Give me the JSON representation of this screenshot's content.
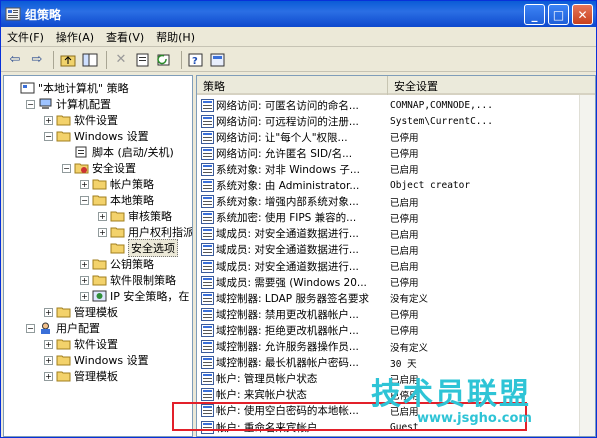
{
  "window": {
    "title": "组策略",
    "minimize": "_",
    "maximize": "□",
    "close": "✕"
  },
  "menu": [
    "文件(F)",
    "操作(A)",
    "查看(V)",
    "帮助(H)"
  ],
  "toolbar_icons": [
    "back-icon",
    "forward-icon",
    "up-folder-icon",
    "show-hide-tree-icon",
    "delete-icon",
    "properties-icon",
    "refresh-icon",
    "help-icon",
    "export-icon"
  ],
  "tree": [
    {
      "label": "\"本地计算机\" 策略",
      "indent": 0,
      "expander": "",
      "icon": "policy"
    },
    {
      "label": "计算机配置",
      "indent": 1,
      "expander": "−",
      "icon": "computer"
    },
    {
      "label": "软件设置",
      "indent": 2,
      "expander": "+",
      "icon": "folder"
    },
    {
      "label": "Windows 设置",
      "indent": 2,
      "expander": "−",
      "icon": "folder"
    },
    {
      "label": "脚本 (启动/关机)",
      "indent": 3,
      "expander": "",
      "icon": "script"
    },
    {
      "label": "安全设置",
      "indent": 3,
      "expander": "−",
      "icon": "security"
    },
    {
      "label": "帐户策略",
      "indent": 4,
      "expander": "+",
      "icon": "folder"
    },
    {
      "label": "本地策略",
      "indent": 4,
      "expander": "−",
      "icon": "folder"
    },
    {
      "label": "审核策略",
      "indent": 5,
      "expander": "+",
      "icon": "folder"
    },
    {
      "label": "用户权利指派",
      "indent": 5,
      "expander": "+",
      "icon": "folder"
    },
    {
      "label": "安全选项",
      "indent": 5,
      "expander": "",
      "icon": "folder",
      "selected": true
    },
    {
      "label": "公钥策略",
      "indent": 4,
      "expander": "+",
      "icon": "folder"
    },
    {
      "label": "软件限制策略",
      "indent": 4,
      "expander": "+",
      "icon": "folder"
    },
    {
      "label": "IP 安全策略，在",
      "indent": 4,
      "expander": "+",
      "icon": "ipsec"
    },
    {
      "label": "管理模板",
      "indent": 2,
      "expander": "+",
      "icon": "folder"
    },
    {
      "label": "用户配置",
      "indent": 1,
      "expander": "−",
      "icon": "user"
    },
    {
      "label": "软件设置",
      "indent": 2,
      "expander": "+",
      "icon": "folder"
    },
    {
      "label": "Windows 设置",
      "indent": 2,
      "expander": "+",
      "icon": "folder"
    },
    {
      "label": "管理模板",
      "indent": 2,
      "expander": "+",
      "icon": "folder"
    }
  ],
  "list": {
    "columns": [
      "策略",
      "安全设置"
    ],
    "rows": [
      {
        "policy": "网络访问: 可匿名访问的命名...",
        "setting": "COMNAP,COMNODE,..."
      },
      {
        "policy": "网络访问: 可远程访问的注册...",
        "setting": "System\\CurrentC..."
      },
      {
        "policy": "网络访问: 让\"每个人\"权限...",
        "setting": "已停用"
      },
      {
        "policy": "网络访问: 允许匿名 SID/名...",
        "setting": "已停用"
      },
      {
        "policy": "系统对象: 对非 Windows 子...",
        "setting": "已启用"
      },
      {
        "policy": "系统对象: 由 Administrator...",
        "setting": "Object creator"
      },
      {
        "policy": "系统对象: 增强内部系统对象...",
        "setting": "已启用"
      },
      {
        "policy": "系统加密: 使用 FIPS 兼容的...",
        "setting": "已停用"
      },
      {
        "policy": "域成员: 对安全通道数据进行...",
        "setting": "已启用"
      },
      {
        "policy": "域成员: 对安全通道数据进行...",
        "setting": "已启用"
      },
      {
        "policy": "域成员: 对安全通道数据进行...",
        "setting": "已启用"
      },
      {
        "policy": "域成员: 需要强 (Windows 20...",
        "setting": "已停用"
      },
      {
        "policy": "域控制器: LDAP 服务器签名要求",
        "setting": "没有定义"
      },
      {
        "policy": "域控制器: 禁用更改机器帐户...",
        "setting": "已停用"
      },
      {
        "policy": "域控制器: 拒绝更改机器帐户...",
        "setting": "已停用"
      },
      {
        "policy": "域控制器: 允许服务器操作员...",
        "setting": "没有定义"
      },
      {
        "policy": "域控制器: 最长机器帐户密码...",
        "setting": "30 天"
      },
      {
        "policy": "帐户: 管理员帐户状态",
        "setting": "已启用"
      },
      {
        "policy": "帐户: 来宾帐户状态",
        "setting": "已停用"
      },
      {
        "policy": "帐户: 使用空白密码的本地帐...",
        "setting": "已启用"
      },
      {
        "policy": "帐户: 重命名来宾帐户",
        "setting": "Guest"
      }
    ]
  },
  "watermark": {
    "title": "技术员联盟",
    "url": "www.jsgho.com"
  }
}
